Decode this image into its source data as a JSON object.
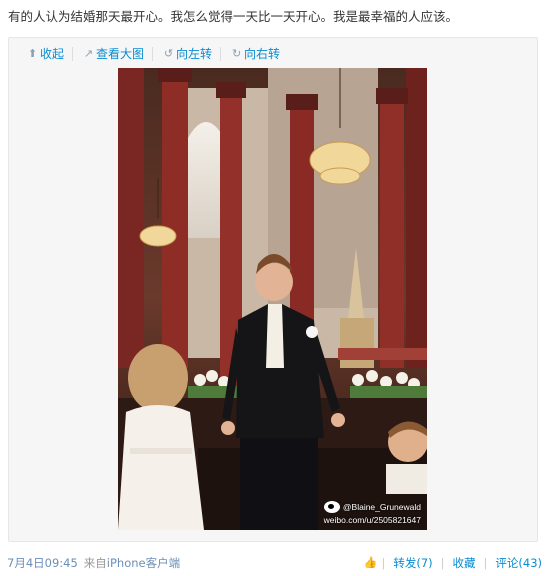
{
  "post": {
    "text": "有的人认为结婚那天最开心。我怎么觉得一天比一天开心。我是最幸福的人应该。"
  },
  "toolbar": {
    "collapse_label": "收起",
    "view_large_label": "查看大图",
    "rotate_left_label": "向左转",
    "rotate_right_label": "向右转"
  },
  "photo": {
    "watermark_handle": "@Blaine_Grunewald",
    "watermark_url": "weibo.com/u/2505821647"
  },
  "footer": {
    "time": "7月4日09:45",
    "source_prefix": "来自",
    "source": "iPhone客户端",
    "repost_label": "转发(7)",
    "favorite_label": "收藏",
    "comment_label": "评论(43)"
  },
  "colors": {
    "link": "#0a8cd2",
    "meta": "#999999",
    "panel_bg": "#f6f6f6"
  }
}
